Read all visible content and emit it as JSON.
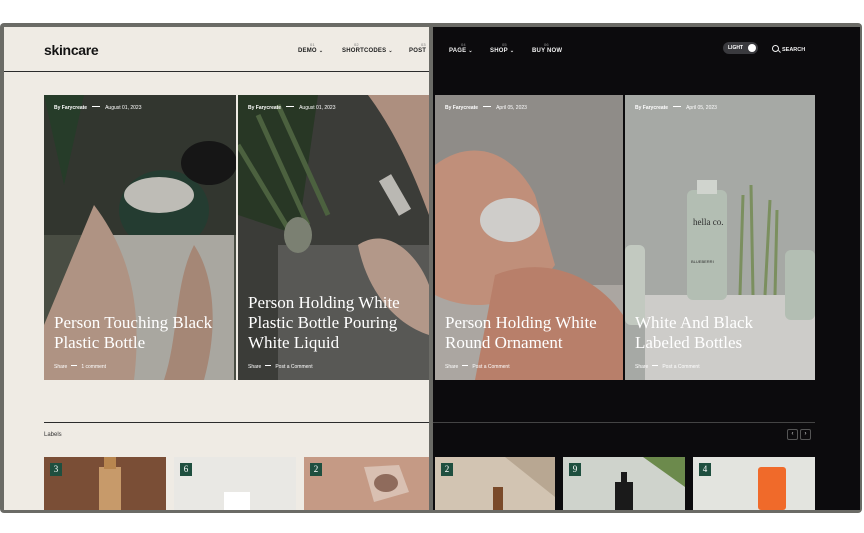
{
  "light": {
    "logo": "skincare",
    "nav": [
      {
        "num": "01",
        "label": "DEMO"
      },
      {
        "num": "02",
        "label": "SHORTCODES"
      },
      {
        "num": "03",
        "label": "POST"
      }
    ],
    "cards": [
      {
        "by": "By Farycreate",
        "date": "August 01, 2023",
        "title": "Person Touching Black Plastic Bottle",
        "share": "Share",
        "comments": "1 comment"
      },
      {
        "by": "By Farycreate",
        "date": "August 01, 2023",
        "title": "Person Holding White Plastic Bottle Pouring White Liquid",
        "share": "Share",
        "comments": "Post a Comment"
      }
    ],
    "labels_heading": "Labels",
    "thumbs": [
      {
        "count": "3"
      },
      {
        "count": "6"
      },
      {
        "count": "2"
      }
    ]
  },
  "dark": {
    "nav": [
      {
        "num": "04",
        "label": "PAGE"
      },
      {
        "num": "05",
        "label": "SHOP"
      },
      {
        "num": "06",
        "label": "BUY NOW"
      }
    ],
    "toggle_label": "LIGHT",
    "search_label": "SEARCH",
    "cards": [
      {
        "by": "By Farycreate",
        "date": "April 05, 2023",
        "title": "Person Holding White Round Ornament",
        "share": "Share",
        "comments": "Post a Comment"
      },
      {
        "by": "By Farycreate",
        "date": "April 05, 2023",
        "title": "White And Black Labeled Bottles",
        "share": "Share",
        "comments": "Post a Comment"
      }
    ],
    "arrows": {
      "prev": "‹",
      "next": "›"
    },
    "thumbs": [
      {
        "count": "2"
      },
      {
        "count": "9"
      },
      {
        "count": "4"
      }
    ],
    "bottle_text": {
      "brand": "hella co.",
      "product": "BLUEBERRI"
    }
  },
  "colors": {
    "light_bg": "#efebe4",
    "dark_bg": "#0c0b0d",
    "badge": "#1f4f3f"
  }
}
